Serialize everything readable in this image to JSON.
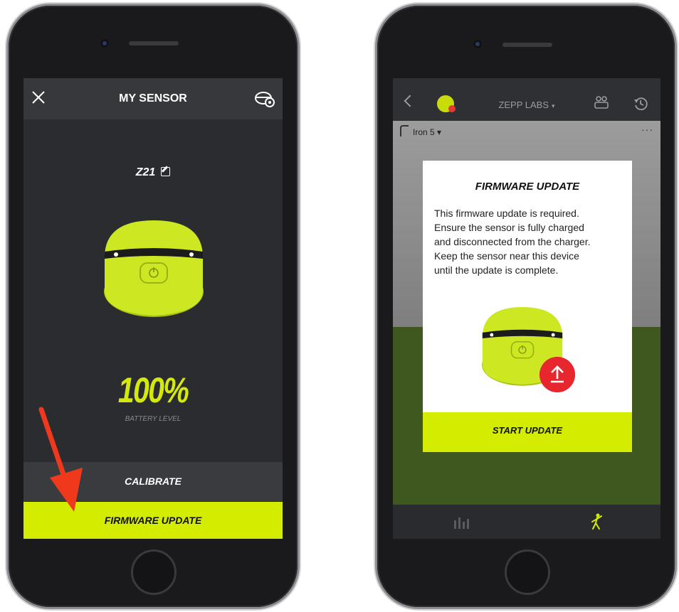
{
  "left_phone": {
    "header": {
      "title": "MY SENSOR"
    },
    "sensor": {
      "name": "Z21"
    },
    "battery": {
      "value": "100%",
      "label": "BATTERY LEVEL"
    },
    "buttons": {
      "calibrate": "CALIBRATE",
      "firmware_update": "FIRMWARE UPDATE"
    }
  },
  "right_phone": {
    "header": {
      "title": "ZEPP LABS",
      "caret": "▾"
    },
    "club": {
      "label": "Iron 5 ▾",
      "more": "···"
    },
    "modal": {
      "title": "FIRMWARE UPDATE",
      "body_lines": [
        "This firmware update is required.",
        "Ensure the sensor is fully charged",
        "and disconnected from the charger.",
        "Keep the sensor near this device",
        "until the update is complete."
      ],
      "button": "START UPDATE"
    }
  },
  "colors": {
    "accent": "#d4ec00",
    "sensor_lime": "#cde822",
    "screen_dark": "#2b2c2f",
    "alert_red": "#e8262d",
    "arrow_red": "#f0391c"
  },
  "icons": [
    "close-icon",
    "sensor-settings-icon",
    "edit-icon",
    "power-icon",
    "red-arrow",
    "back-icon",
    "zepp-logo-icon",
    "friends-icon",
    "history-icon",
    "club-icon",
    "more-icon",
    "upload-icon",
    "stats-icon",
    "golfer-icon"
  ]
}
